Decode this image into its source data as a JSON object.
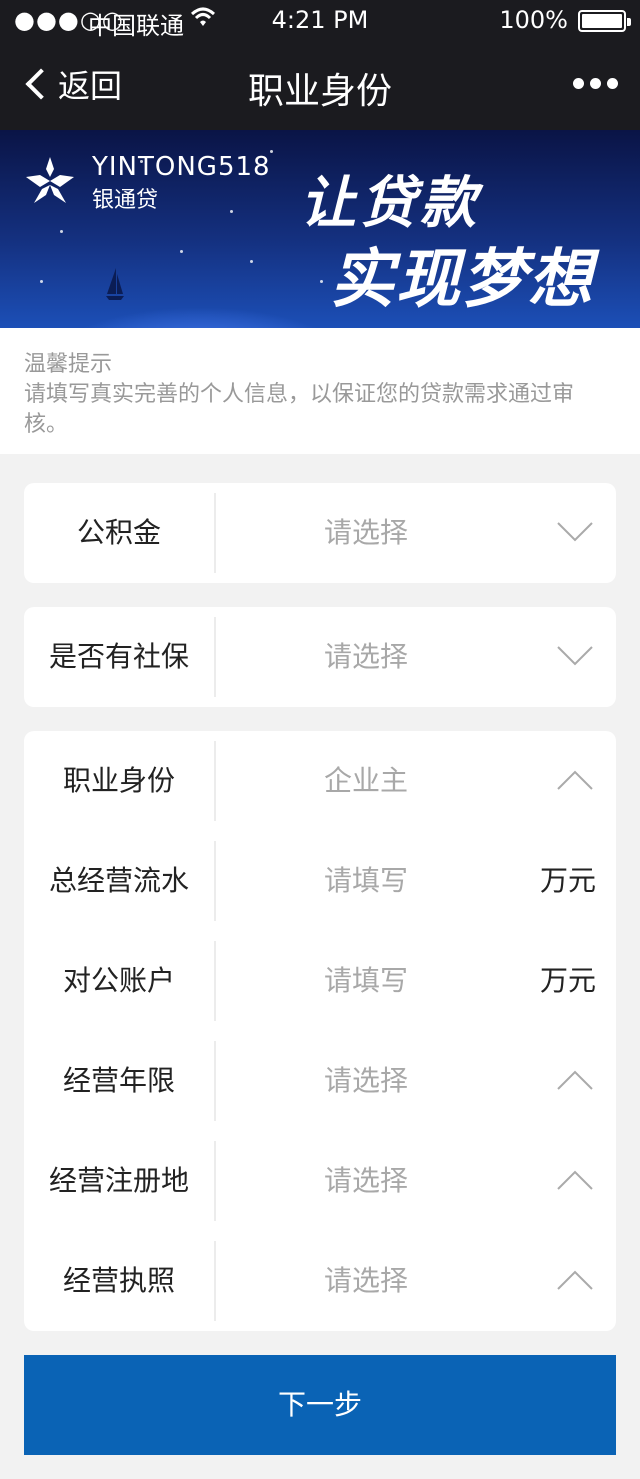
{
  "status_bar": {
    "signal": "●●●○○",
    "carrier": "中国联通",
    "time": "4:21 PM",
    "battery": "100%"
  },
  "nav": {
    "back_label": "返回",
    "title": "职业身份"
  },
  "banner": {
    "brand_en": "YINTONG518",
    "brand_cn": "银通贷",
    "slogan_line1": "让贷款",
    "slogan_line2": "实现梦想"
  },
  "tip": {
    "title": "温馨提示",
    "text": "请填写真实完善的个人信息，以保证您的贷款需求通过审核。"
  },
  "fields": {
    "gongjijin": {
      "label": "公积金",
      "value": "请选择"
    },
    "shebao": {
      "label": "是否有社保",
      "value": "请选择"
    },
    "occupation": {
      "label": "职业身份",
      "value": "企业主"
    },
    "turnover": {
      "label": "总经营流水",
      "placeholder": "请填写",
      "unit": "万元"
    },
    "corp_account": {
      "label": "对公账户",
      "placeholder": "请填写",
      "unit": "万元"
    },
    "years": {
      "label": "经营年限",
      "value": "请选择"
    },
    "reg_place": {
      "label": "经营注册地",
      "value": "请选择"
    },
    "license": {
      "label": "经营执照",
      "value": "请选择"
    }
  },
  "next_button": "下一步",
  "colors": {
    "nav_bg": "#1b1b1f",
    "accent": "#0a63b5",
    "page_bg": "#f2f2f2",
    "placeholder": "#a8a8a8"
  }
}
